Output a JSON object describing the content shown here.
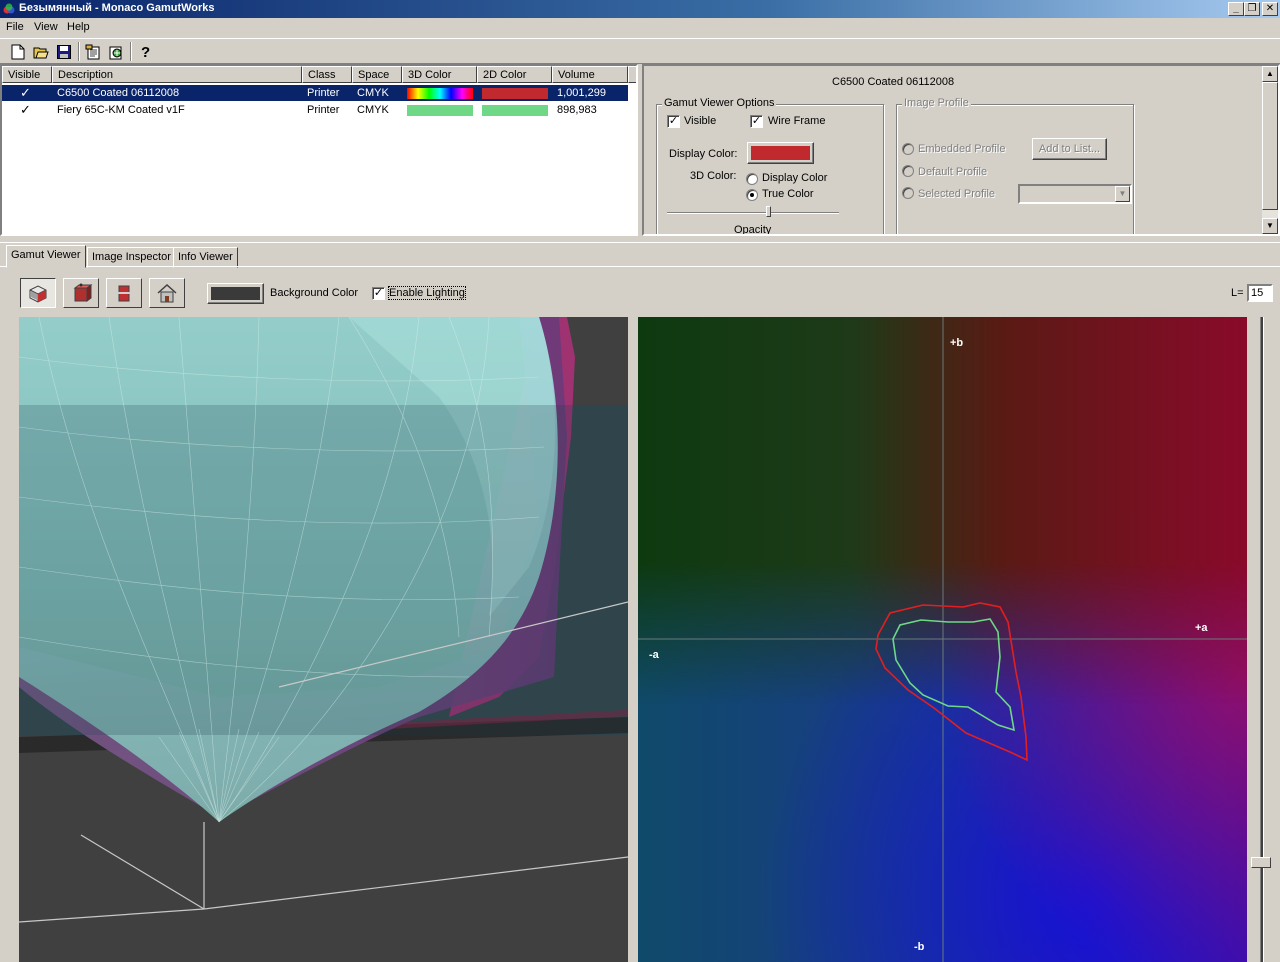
{
  "window": {
    "title": "Безымянный - Monaco GamutWorks",
    "minimize": "_",
    "restore": "❐",
    "close": "✕"
  },
  "menu": [
    "File",
    "View",
    "Help"
  ],
  "toolbar_icons": [
    "new-icon",
    "open-icon",
    "save-icon",
    "import-icon",
    "add-profile-icon",
    "help-icon"
  ],
  "profile_list": {
    "columns": [
      "Visible",
      "Description",
      "Class",
      "Space",
      "3D Color",
      "2D Color",
      "Volume"
    ],
    "rows": [
      {
        "visible": "✓",
        "description": "C6500 Coated 06112008",
        "class": "Printer",
        "space": "CMYK",
        "color_3d": "rainbow",
        "color_2d": "#c0292d",
        "volume": "1,001,299",
        "selected": true
      },
      {
        "visible": "✓",
        "description": "Fiery 65C-KM Coated v1F",
        "class": "Printer",
        "space": "CMYK",
        "color_3d": "#6ed886",
        "color_2d": "#6ed886",
        "volume": "898,983",
        "selected": false
      }
    ]
  },
  "properties": {
    "profile_name": "C6500 Coated 06112008",
    "gamut_viewer_options": {
      "title": "Gamut Viewer Options",
      "visible_label": "Visible",
      "visible_checked": true,
      "wire_frame_label": "Wire Frame",
      "wire_frame_checked": true,
      "display_color_label": "Display Color:",
      "display_color": "#c0292d",
      "color_3d_label": "3D Color:",
      "radio_display_color": "Display Color",
      "radio_true_color": "True Color",
      "selected_3d_color": "True Color",
      "opacity_label": "Opacity",
      "opacity": 0.6
    },
    "image_profile": {
      "title": "Image Profile",
      "embedded": "Embedded Profile",
      "default": "Default Profile",
      "selected": "Selected Profile",
      "add_button": "Add to List...",
      "selected_value": ""
    }
  },
  "tabs": [
    "Gamut Viewer",
    "Image Inspector",
    "Info Viewer"
  ],
  "active_tab": "Gamut Viewer",
  "viewer_toolbar": {
    "buttons": [
      "gamut-view-icon",
      "gamut-cube-icon",
      "gamut-slice-icon",
      "home-view-icon"
    ],
    "background_color_label": "Background Color",
    "background_color": "#3a3a3a",
    "enable_lighting_label": "Enable Lighting",
    "enable_lighting_checked": true,
    "l_label": "L=",
    "l_value": "15"
  },
  "plot_2d": {
    "labels": {
      "plus_b": "+b",
      "minus_b": "-b",
      "plus_a": "+a",
      "minus_a": "-a"
    },
    "L": 15,
    "series": [
      {
        "name": "C6500 Coated 06112008",
        "color": "#e02020"
      },
      {
        "name": "Fiery 65C-KM Coated v1F",
        "color": "#6ed886"
      }
    ]
  }
}
